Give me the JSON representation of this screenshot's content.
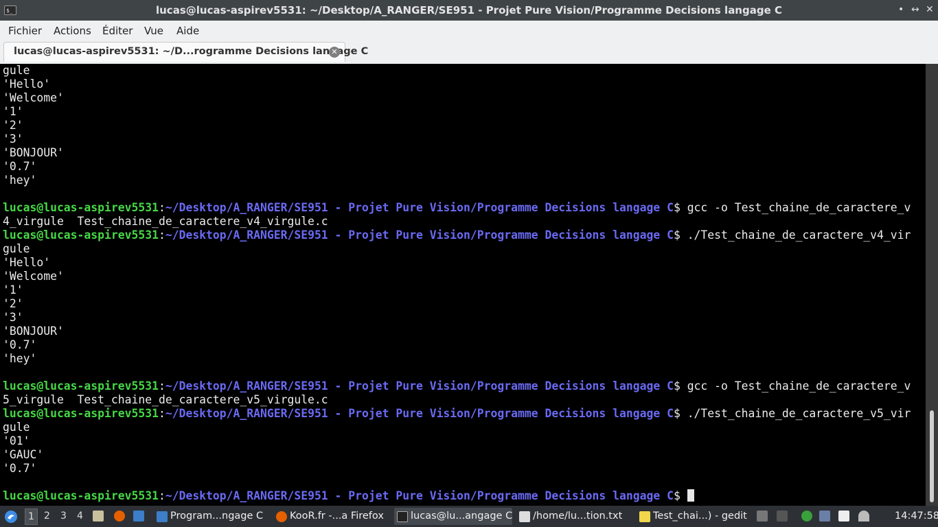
{
  "window": {
    "app_icon": "$_",
    "title": "lucas@lucas-aspirev5531: ~/Desktop/A_RANGER/SE951 - Projet Pure Vision/Programme Decisions langage C",
    "minimize": "•",
    "maximize": "↔",
    "close": "✕"
  },
  "menu": {
    "items": [
      "Fichier",
      "Actions",
      "Éditer",
      "Vue",
      "Aide"
    ]
  },
  "tab": {
    "title": "lucas@lucas-aspirev5531: ~/D...rogramme Decisions langage C",
    "close_icon": "close-icon"
  },
  "terminal": {
    "lines": [
      {
        "out": "gule"
      },
      {
        "out": "'Hello'"
      },
      {
        "out": "'Welcome'"
      },
      {
        "out": "'1'"
      },
      {
        "out": "'2'"
      },
      {
        "out": "'3'"
      },
      {
        "out": "'BONJOUR'"
      },
      {
        "out": "'0.7'"
      },
      {
        "out": "'hey'"
      },
      {
        "out": ""
      },
      {
        "user": "lucas@lucas-aspirev5531",
        "path": "~/Desktop/A_RANGER/SE951 - Projet Pure Vision/Programme Decisions langage C",
        "cmd": "$ gcc -o Test_chaine_de_caractere_v"
      },
      {
        "out": "4_virgule  Test_chaine_de_caractere_v4_virgule.c"
      },
      {
        "user": "lucas@lucas-aspirev5531",
        "path": "~/Desktop/A_RANGER/SE951 - Projet Pure Vision/Programme Decisions langage C",
        "cmd": "$ ./Test_chaine_de_caractere_v4_vir"
      },
      {
        "out": "gule"
      },
      {
        "out": "'Hello'"
      },
      {
        "out": "'Welcome'"
      },
      {
        "out": "'1'"
      },
      {
        "out": "'2'"
      },
      {
        "out": "'3'"
      },
      {
        "out": "'BONJOUR'"
      },
      {
        "out": "'0.7'"
      },
      {
        "out": "'hey'"
      },
      {
        "out": ""
      },
      {
        "user": "lucas@lucas-aspirev5531",
        "path": "~/Desktop/A_RANGER/SE951 - Projet Pure Vision/Programme Decisions langage C",
        "cmd": "$ gcc -o Test_chaine_de_caractere_v"
      },
      {
        "out": "5_virgule  Test_chaine_de_caractere_v5_virgule.c"
      },
      {
        "user": "lucas@lucas-aspirev5531",
        "path": "~/Desktop/A_RANGER/SE951 - Projet Pure Vision/Programme Decisions langage C",
        "cmd": "$ ./Test_chaine_de_caractere_v5_vir"
      },
      {
        "out": "gule"
      },
      {
        "out": "'01'"
      },
      {
        "out": "'GAUC'"
      },
      {
        "out": "'0.7'"
      },
      {
        "out": ""
      },
      {
        "user": "lucas@lucas-aspirev5531",
        "path": "~/Desktop/A_RANGER/SE951 - Projet Pure Vision/Programme Decisions langage C",
        "cmd": "$ ",
        "cursor": true
      }
    ]
  },
  "taskbar": {
    "workspaces": [
      "1",
      "2",
      "3",
      "4"
    ],
    "tasks": [
      {
        "label": "Program...ngage C",
        "icon": "folder-icon",
        "color": "#3c7ec7"
      },
      {
        "label": "KooR.fr -...a Firefox",
        "icon": "firefox-icon",
        "color": "#e66000"
      },
      {
        "label": "lucas@lu...angage C",
        "icon": "terminal-icon",
        "color": "#222222"
      },
      {
        "label": "/home/lu...tion.txt",
        "icon": "text-file-icon",
        "color": "#dddddd"
      },
      {
        "label": "Test_chai...) - gedit",
        "icon": "gedit-icon",
        "color": "#f2d64b"
      }
    ],
    "clock": "14:47:58"
  },
  "colors": {
    "prompt_user": "#46d846",
    "prompt_path": "#6a6af4",
    "terminal_bg": "#000000",
    "terminal_fg": "#ececec"
  }
}
